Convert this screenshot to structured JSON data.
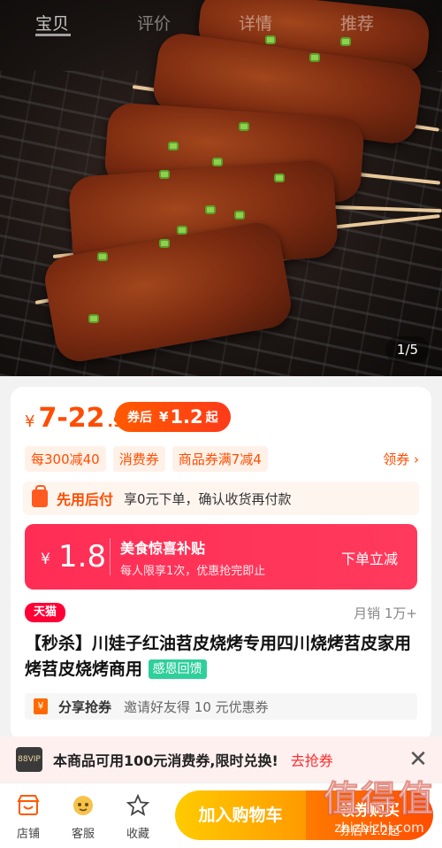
{
  "top_tabs": [
    "宝贝",
    "评价",
    "详情",
    "推荐"
  ],
  "image_counter": "1/5",
  "price": {
    "yen": "¥",
    "main": "7-22",
    "tail": ".9",
    "after_coupon_label": "券后",
    "after_coupon_yen": "¥",
    "after_coupon_value": "1.2",
    "after_coupon_suffix": "起"
  },
  "coupons": [
    "每300减40",
    "消费券",
    "商品券满7减4"
  ],
  "get_coupon": "领券 ›",
  "pay_later": {
    "title": "先用后付",
    "desc": "享0元下单，确认收货再付款"
  },
  "subsidy": {
    "yen": "¥",
    "amount": "1.8",
    "title": "美食惊喜补贴",
    "desc": "每人限享1次，优惠抢完即止",
    "cta": "下单立减"
  },
  "store_badge": "天猫",
  "sales": "月销 1万+",
  "product_title": "【秒杀】川娃子红油苕皮烧烤专用四川烧烤苕皮家用烤苕皮烧烤商用",
  "gift_badge": "感恩回馈",
  "share": {
    "icon": "¥",
    "title": "分享抢券",
    "desc": "邀请好友得 10 元优惠券"
  },
  "banner": {
    "vip": "88VIP",
    "text": "本商品可用100元消费券,限时兑换!",
    "link": "去抢券",
    "close": "✕"
  },
  "bottom_nav": {
    "store": "店铺",
    "service": "客服",
    "favorite": "收藏"
  },
  "cart_button": "加入购物车",
  "buy_button": {
    "line1": "领券购买",
    "line2": "券后¥1.2起"
  },
  "watermark": {
    "line1": "值得值",
    "line2": "zhizhizhi.com"
  },
  "colors": {
    "accent": "#ff4d00",
    "subsidy": "#ff2d55",
    "tmall": "#ff0036",
    "cart": "#ffb000"
  }
}
